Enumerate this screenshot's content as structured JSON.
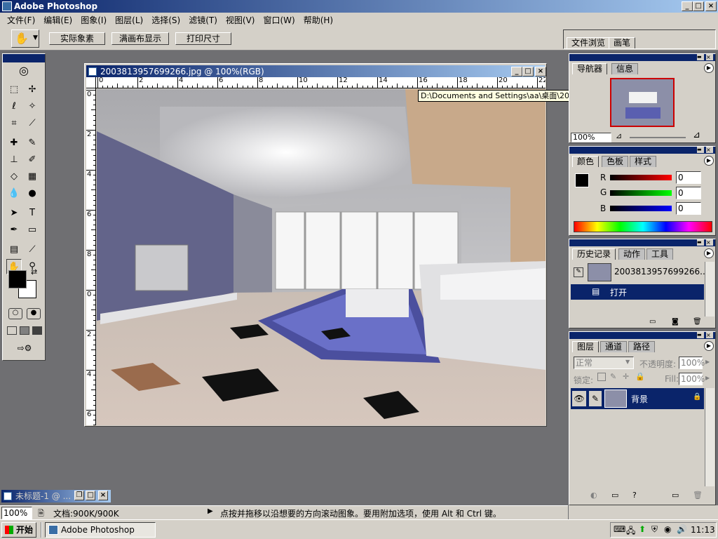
{
  "app": {
    "title": "Adobe Photoshop"
  },
  "menu": [
    "文件(F)",
    "编辑(E)",
    "图象(I)",
    "图层(L)",
    "选择(S)",
    "滤镜(T)",
    "视图(V)",
    "窗口(W)",
    "帮助(H)"
  ],
  "options": {
    "actual_pixels": "实际象素",
    "fit_screen": "满画布显示",
    "print_size": "打印尺寸"
  },
  "palette_well": {
    "file_browser": "文件浏览",
    "brushes": "画笔"
  },
  "document": {
    "title": "2003813957699266.jpg @ 100%(RGB)",
    "tooltip": "D:\\Documents and Settings\\aa\\桌面\\2003813957699266.jpg @ 100%(RGB)",
    "ruler_h": [
      "0",
      "2",
      "4",
      "6",
      "8",
      "10",
      "12",
      "14",
      "16",
      "18",
      "20",
      "22"
    ],
    "ruler_v": [
      "0",
      "2",
      "4",
      "6",
      "8",
      "0",
      "2",
      "4",
      "6"
    ]
  },
  "navigator": {
    "tab1": "导航器",
    "tab2": "信息",
    "zoom": "100%"
  },
  "color": {
    "tab1": "颜色",
    "tab2": "色板",
    "tab3": "样式",
    "r_label": "R",
    "g_label": "G",
    "b_label": "B",
    "r": "0",
    "g": "0",
    "b": "0"
  },
  "history": {
    "tab1": "历史记录",
    "tab2": "动作",
    "tab3": "工具",
    "snapshot": "2003813957699266...",
    "step": "打开"
  },
  "layers": {
    "tab1": "图层",
    "tab2": "通道",
    "tab3": "路径",
    "blend": "正常",
    "opacity_label": "不透明度:",
    "opacity": "100%",
    "lock_label": "锁定:",
    "fill_label": "Fill:",
    "fill": "100%",
    "layer_name": "背景"
  },
  "minimized": {
    "title": "未标题-1 @ ..."
  },
  "status": {
    "zoom": "100%",
    "doc": "文档:900K/900K",
    "hint": "点按并拖移以沿想要的方向滚动图象。要用附加选项，使用 Alt 和 Ctrl 键。"
  },
  "taskbar": {
    "start": "开始",
    "app_button": "Adobe Photoshop",
    "clock": "11:13"
  },
  "colors": {
    "title_dark": "#0a246a",
    "title_light": "#a6caf0",
    "face": "#d4d0c8",
    "workspace": "#6f6f72"
  }
}
